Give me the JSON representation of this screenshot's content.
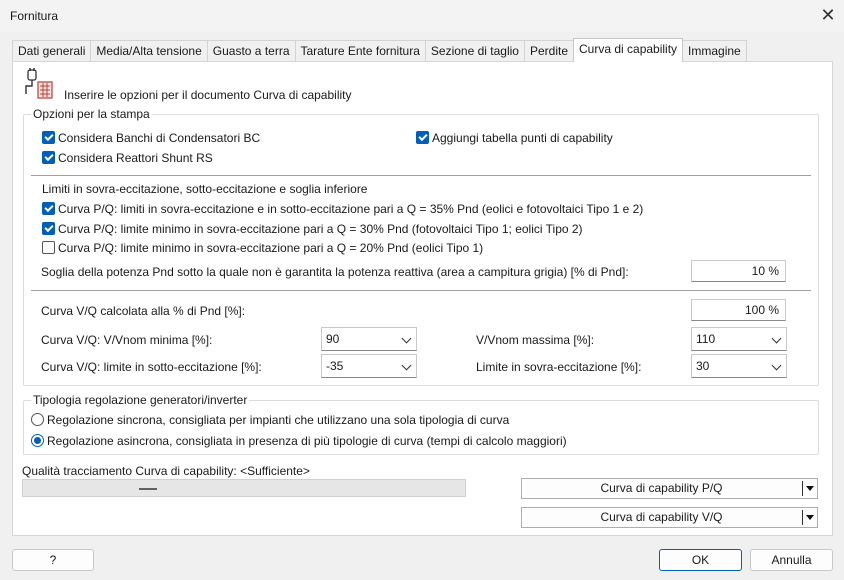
{
  "window": {
    "title": "Fornitura",
    "close_icon": "close-icon"
  },
  "tabs": [
    {
      "label": "Dati generali",
      "active": false
    },
    {
      "label": "Media/Alta tensione",
      "active": false
    },
    {
      "label": "Guasto a terra",
      "active": false
    },
    {
      "label": "Tarature Ente fornitura",
      "active": false
    },
    {
      "label": "Sezione di taglio",
      "active": false
    },
    {
      "label": "Perdite",
      "active": false
    },
    {
      "label": "Curva di capability",
      "active": true
    },
    {
      "label": "Immagine",
      "active": false
    }
  ],
  "header": {
    "icon": "plug-document-icon",
    "text": "Inserire le opzioni per il documento Curva di capability"
  },
  "print_options": {
    "legend": "Opzioni per la stampa",
    "bc": {
      "label": "Considera Banchi di Condensatori BC",
      "checked": true
    },
    "rs": {
      "label": "Considera Reattori Shunt RS",
      "checked": true
    },
    "table": {
      "label": "Aggiungi tabella punti di capability",
      "checked": true
    },
    "limits_title": "Limiti in sovra-eccitazione, sotto-eccitazione e soglia inferiore",
    "limit1": {
      "label": "Curva P/Q: limiti in sovra-eccitazione e in sotto-eccitazione pari a Q = 35% Pnd (eolici e fotovoltaici Tipo 1 e 2)",
      "checked": true
    },
    "limit2": {
      "label": "Curva P/Q: limite minimo in sovra-eccitazione pari a Q = 30% Pnd (fotovoltaici Tipo 1; eolici Tipo 2)",
      "checked": true
    },
    "limit3": {
      "label": "Curva P/Q: limite minimo in sovra-eccitazione pari a Q = 20% Pnd (eolici Tipo 1)",
      "checked": false
    },
    "threshold": {
      "label": "Soglia della potenza Pnd sotto la quale non è garantita la potenza reattiva (area a campitura grigia) [% di Pnd]:",
      "value": "10 %"
    },
    "vq_pct": {
      "label": "Curva V/Q calcolata alla % di Pnd [%]:",
      "value": "100 %"
    },
    "vmin": {
      "label": "Curva V/Q: V/Vnom minima [%]:",
      "value": "90"
    },
    "vmax": {
      "label": "V/Vnom massima [%]:",
      "value": "110"
    },
    "under": {
      "label": "Curva V/Q: limite in sotto-eccitazione [%]:",
      "value": "-35"
    },
    "over": {
      "label": "Limite in sovra-eccitazione [%]:",
      "value": "30"
    }
  },
  "regulation": {
    "legend": "Tipologia regolazione generatori/inverter",
    "sync": {
      "label": "Regolazione sincrona, consigliata per impianti che utilizzano una sola tipologia di curva",
      "selected": false
    },
    "async": {
      "label": "Regolazione asincrona, consigliata in presenza di più tipologie di curva (tempi di calcolo maggiori)",
      "selected": true
    }
  },
  "quality": {
    "label": "Qualità tracciamento Curva di capability: <Sufficiente>",
    "slider_position": 0.29
  },
  "buttons": {
    "pq": "Curva di capability P/Q",
    "vq": "Curva di capability V/Q",
    "help": "?",
    "ok": "OK",
    "cancel": "Annulla"
  },
  "colors": {
    "accent": "#005fb8",
    "background": "#f0f0f0",
    "panel": "#ffffff"
  }
}
